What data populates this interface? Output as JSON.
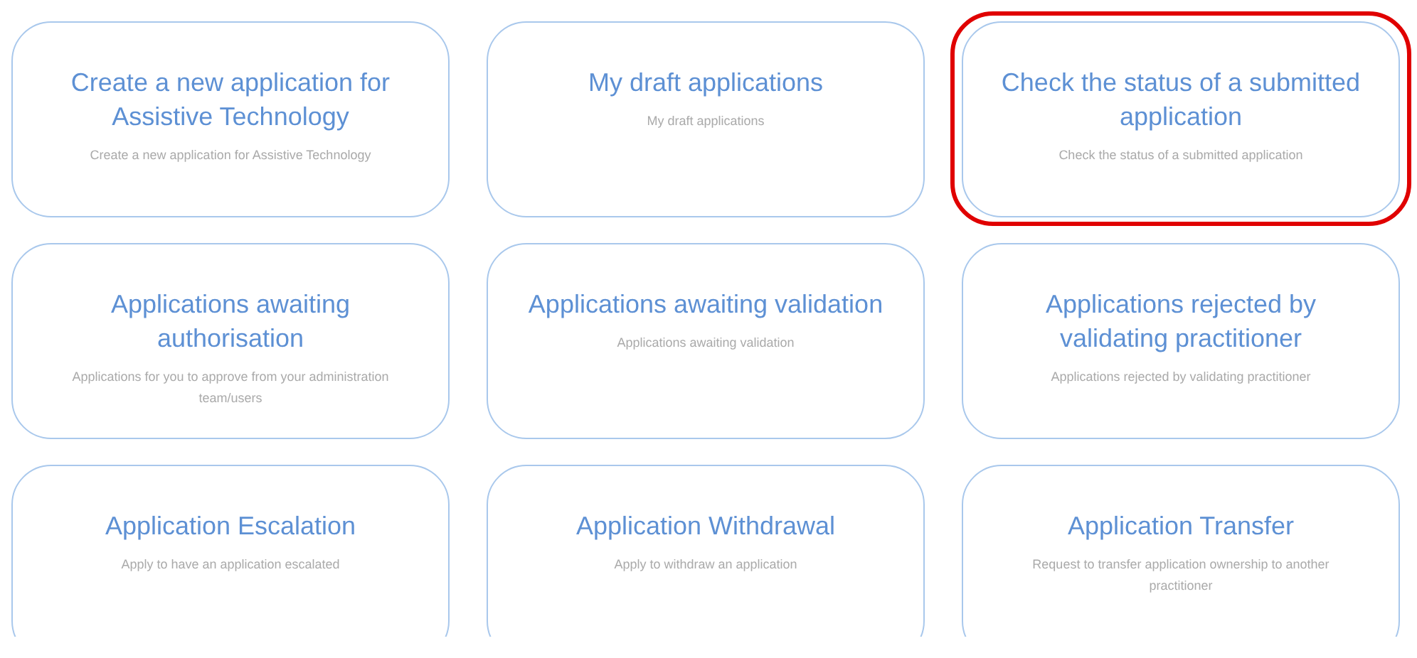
{
  "cards": [
    {
      "title": "Create a new application for Assistive Technology",
      "description": "Create a new application for Assistive Technology",
      "highlighted": false
    },
    {
      "title": "My draft applications",
      "description": "My draft applications",
      "highlighted": false
    },
    {
      "title": "Check the status of a submitted application",
      "description": "Check the status of a submitted application",
      "highlighted": true
    },
    {
      "title": "Applications awaiting authorisation",
      "description": "Applications for you to approve from your administration team/users",
      "highlighted": false
    },
    {
      "title": "Applications awaiting validation",
      "description": "Applications awaiting validation",
      "highlighted": false
    },
    {
      "title": "Applications rejected by validating practitioner",
      "description": "Applications rejected by validating practitioner",
      "highlighted": false
    },
    {
      "title": "Application Escalation",
      "description": "Apply to have an application escalated",
      "highlighted": false
    },
    {
      "title": "Application Withdrawal",
      "description": "Apply to withdraw an application",
      "highlighted": false
    },
    {
      "title": "Application Transfer",
      "description": "Request to transfer application ownership to another practitioner",
      "highlighted": false
    }
  ]
}
